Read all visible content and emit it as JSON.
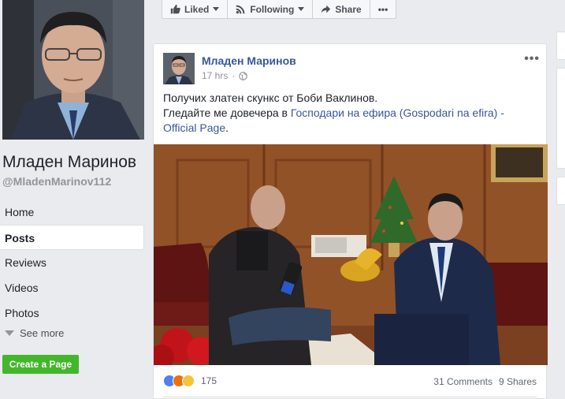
{
  "page": {
    "name": "Младен Маринов",
    "handle": "@MladenMarinov112"
  },
  "nav": {
    "items": [
      {
        "label": "Home",
        "active": false
      },
      {
        "label": "Posts",
        "active": true
      },
      {
        "label": "Reviews",
        "active": false
      },
      {
        "label": "Videos",
        "active": false
      },
      {
        "label": "Photos",
        "active": false
      }
    ],
    "see_more": "See more",
    "create_page": "Create a Page"
  },
  "action_bar": {
    "liked": "Liked",
    "following": "Following",
    "share": "Share",
    "more": "•••"
  },
  "post": {
    "author": "Младен Маринов",
    "time": "17 hrs",
    "line1": "Получих златен скункс от Боби Ваклинов.",
    "line2_prefix": "Гледайте ме довечера в ",
    "link": "Господари на ефира (Gospodari na efira) - Official Page",
    "line2_suffix": ".",
    "reaction_count": "175",
    "comments": "31 Comments",
    "shares": "9 Shares",
    "more": "•••"
  },
  "colors": {
    "link": "#365899",
    "green": "#42b72a",
    "background": "#e9ebee"
  },
  "icons": {
    "globe": "globe-icon",
    "like_reaction": "like-reaction-icon",
    "angry_reaction": "angry-reaction-icon",
    "wow_reaction": "wow-reaction-icon"
  }
}
